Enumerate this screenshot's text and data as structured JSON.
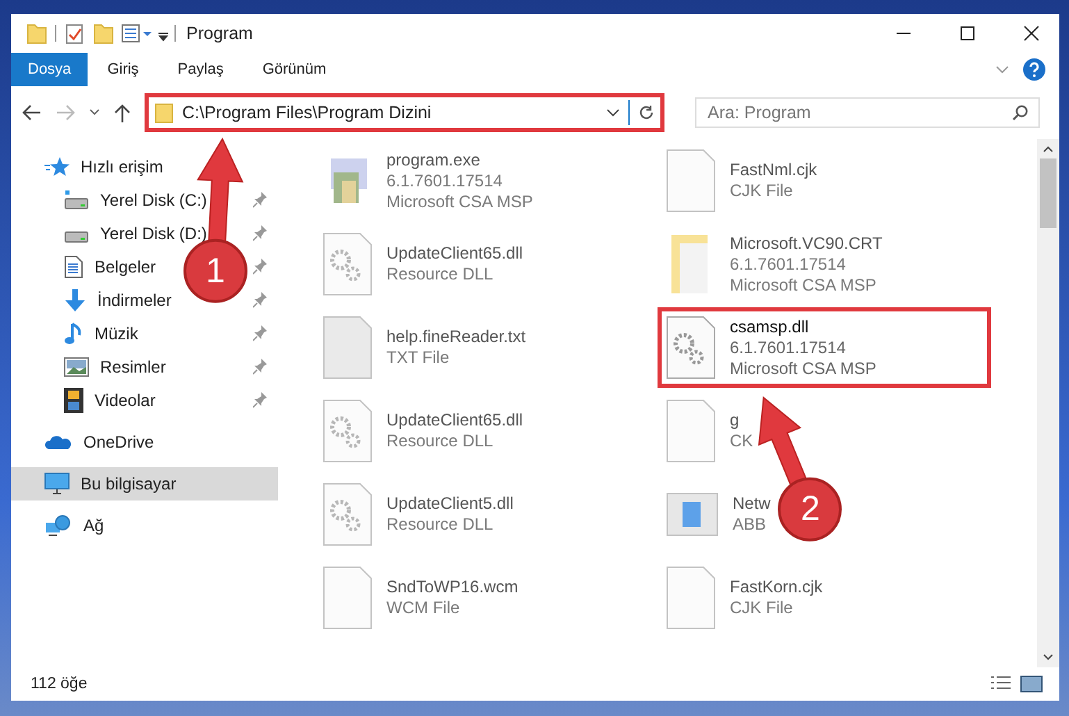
{
  "window": {
    "title": "Program"
  },
  "ribbon_tabs": [
    {
      "label": "Dosya",
      "selected": true
    },
    {
      "label": "Giriş",
      "selected": false
    },
    {
      "label": "Paylaş",
      "selected": false
    },
    {
      "label": "Görünüm",
      "selected": false
    }
  ],
  "address": {
    "path": "C:\\Program Files\\Program Dizini",
    "highlighted": true
  },
  "search": {
    "placeholder": "Ara: Program"
  },
  "sidebar": {
    "items": [
      {
        "label": "Hızlı erişim",
        "kind": "star",
        "selected": false,
        "children": [
          {
            "label": "Yerel Disk (C:)",
            "kind": "drive-c",
            "pinned": true
          },
          {
            "label": "Yerel Disk (D:)",
            "kind": "drive",
            "pinned": true
          },
          {
            "label": "Belgeler",
            "kind": "document",
            "pinned": true
          },
          {
            "label": "İndirmeler",
            "kind": "download",
            "pinned": true
          },
          {
            "label": "Müzik",
            "kind": "music",
            "pinned": true
          },
          {
            "label": "Resimler",
            "kind": "image",
            "pinned": true
          },
          {
            "label": "Videolar",
            "kind": "film",
            "pinned": true
          }
        ]
      },
      {
        "label": "OneDrive",
        "kind": "cloud",
        "selected": false
      },
      {
        "label": "Bu bilgisayar",
        "kind": "computer",
        "selected": true
      },
      {
        "label": "Ağ",
        "kind": "network",
        "selected": false
      }
    ]
  },
  "files": [
    {
      "name": "program.exe",
      "details": [
        "6.1.7601.17514",
        "Microsoft CSA MSP"
      ],
      "kind": "exe",
      "blurred": true,
      "highlighted": false
    },
    {
      "name": "FastNml.cjk",
      "details": [
        "CJK File"
      ],
      "kind": "blank",
      "blurred": true,
      "highlighted": false
    },
    {
      "name": "UpdateClient65.dll",
      "details": [
        "Resource DLL"
      ],
      "kind": "gear",
      "blurred": true,
      "highlighted": false
    },
    {
      "name": "Microsoft.VC90.CRT",
      "details": [
        "6.1.7601.17514",
        "Microsoft CSA MSP"
      ],
      "kind": "folder",
      "blurred": true,
      "highlighted": false
    },
    {
      "name": "help.fineReader.txt",
      "details": [
        "TXT File"
      ],
      "kind": "gray",
      "blurred": true,
      "highlighted": false
    },
    {
      "name": "csamsp.dll",
      "details": [
        "6.1.7601.17514",
        "Microsoft CSA MSP"
      ],
      "kind": "gear",
      "blurred": false,
      "highlighted": true
    },
    {
      "name": "UpdateClient65.dll",
      "details": [
        "Resource DLL"
      ],
      "kind": "gear",
      "blurred": true,
      "highlighted": false
    },
    {
      "name": "g",
      "details": [
        "CK"
      ],
      "kind": "blank",
      "blurred": true,
      "highlighted": false
    },
    {
      "name": "UpdateClient5.dll",
      "details": [
        "Resource DLL"
      ],
      "kind": "gear",
      "blurred": true,
      "highlighted": false
    },
    {
      "name": "Netw",
      "details": [
        "ABB"
      ],
      "kind": "window",
      "blurred": true,
      "highlighted": false
    },
    {
      "name": "SndToWP16.wcm",
      "details": [
        "WCM File"
      ],
      "kind": "blank",
      "blurred": true,
      "highlighted": false
    },
    {
      "name": "FastKorn.cjk",
      "details": [
        "CJK File"
      ],
      "kind": "blank",
      "blurred": true,
      "highlighted": false
    }
  ],
  "status_bar": {
    "count": "112 öğe"
  },
  "callouts": [
    {
      "label": "1"
    },
    {
      "label": "2"
    }
  ]
}
